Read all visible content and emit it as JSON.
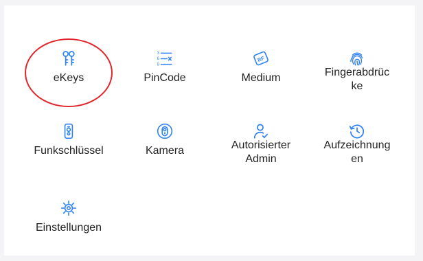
{
  "colors": {
    "icon": "#2f82f6",
    "label": "#222222",
    "highlight": "#e0262c"
  },
  "menu": {
    "items": [
      {
        "label": "eKeys",
        "icon": "keys-icon"
      },
      {
        "label": "PinCode",
        "icon": "pincode-list-icon"
      },
      {
        "label": "Medium",
        "icon": "rf-card-icon"
      },
      {
        "label": "Fingerabdrüc\nke",
        "icon": "fingerprint-icon"
      },
      {
        "label": "Funkschlüssel",
        "icon": "remote-fob-icon"
      },
      {
        "label": "Kamera",
        "icon": "camera-icon"
      },
      {
        "label": "Autorisierter\nAdmin",
        "icon": "admin-user-icon"
      },
      {
        "label": "Aufzeichnung\nen",
        "icon": "history-clock-icon"
      },
      {
        "label": "Einstellungen",
        "icon": "settings-gear-icon"
      }
    ]
  }
}
